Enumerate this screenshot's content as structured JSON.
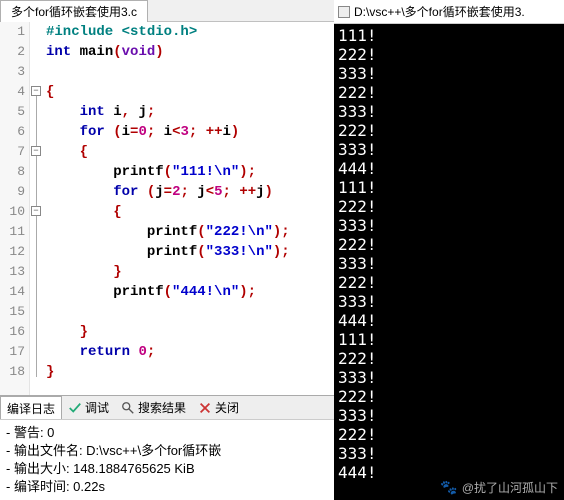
{
  "editor": {
    "tab_title": "多个for循环嵌套使用3.c",
    "lines": [
      {
        "n": 1,
        "html": "<span class='pp'>#include &lt;stdio.h&gt;</span>"
      },
      {
        "n": 2,
        "html": "<span class='kw'>int</span> <span class='id'>main</span><span class='pun'>(</span><span class='typ'>void</span><span class='pun'>)</span>"
      },
      {
        "n": 3,
        "html": ""
      },
      {
        "n": 4,
        "html": "<span class='pun'>{</span>"
      },
      {
        "n": 5,
        "html": "    <span class='kw'>int</span> <span class='id'>i</span><span class='pun'>,</span> <span class='id'>j</span><span class='pun'>;</span>"
      },
      {
        "n": 6,
        "html": "    <span class='kw'>for</span> <span class='pun'>(</span><span class='id'>i</span><span class='pun'>=</span><span class='num'>0</span><span class='pun'>;</span> <span class='id'>i</span><span class='pun'>&lt;</span><span class='num'>3</span><span class='pun'>;</span> <span class='pun'>++</span><span class='id'>i</span><span class='pun'>)</span>"
      },
      {
        "n": 7,
        "html": "    <span class='pun'>{</span>"
      },
      {
        "n": 8,
        "html": "        <span class='id'>printf</span><span class='pun'>(</span><span class='str'>\"111!\\n\"</span><span class='pun'>);</span>"
      },
      {
        "n": 9,
        "html": "        <span class='kw'>for</span> <span class='pun'>(</span><span class='id'>j</span><span class='pun'>=</span><span class='num'>2</span><span class='pun'>;</span> <span class='id'>j</span><span class='pun'>&lt;</span><span class='num'>5</span><span class='pun'>;</span> <span class='pun'>++</span><span class='id'>j</span><span class='pun'>)</span>"
      },
      {
        "n": 10,
        "html": "        <span class='pun'>{</span>"
      },
      {
        "n": 11,
        "html": "            <span class='id'>printf</span><span class='pun'>(</span><span class='str'>\"222!\\n\"</span><span class='pun'>);</span>"
      },
      {
        "n": 12,
        "html": "            <span class='id'>printf</span><span class='pun'>(</span><span class='str'>\"333!\\n\"</span><span class='pun'>);</span>"
      },
      {
        "n": 13,
        "html": "        <span class='pun'>}</span>"
      },
      {
        "n": 14,
        "html": "        <span class='id'>printf</span><span class='pun'>(</span><span class='str'>\"444!\\n\"</span><span class='pun'>);</span>"
      },
      {
        "n": 15,
        "html": ""
      },
      {
        "n": 16,
        "html": "    <span class='pun'>}</span>"
      },
      {
        "n": 17,
        "html": "    <span class='kw'>return</span> <span class='num'>0</span><span class='pun'>;</span>"
      },
      {
        "n": 18,
        "html": "<span class='pun'>}</span>"
      }
    ],
    "fold_boxes": [
      4,
      7,
      10
    ],
    "fold_range": {
      "start": 4,
      "end": 18
    }
  },
  "bottom": {
    "tabs": {
      "log": "编译日志",
      "debug": "调试",
      "search": "搜索结果",
      "close": "关闭"
    },
    "log": {
      "warnings_label": "- 警告: ",
      "warnings_count": "0",
      "output_file_label": "- 输出文件名: ",
      "output_file": "D:\\vsc++\\多个for循环嵌",
      "output_size_label": "- 输出大小: ",
      "output_size": "148.1884765625 KiB",
      "compile_time_label": "- 编译时间: ",
      "compile_time": "0.22s"
    }
  },
  "console": {
    "title": "D:\\vsc++\\多个for循环嵌套使用3.",
    "output": "111!\n222!\n333!\n222!\n333!\n222!\n333!\n444!\n111!\n222!\n333!\n222!\n333!\n222!\n333!\n444!\n111!\n222!\n333!\n222!\n333!\n222!\n333!\n444!"
  },
  "watermark": "@扰了山河孤山下"
}
